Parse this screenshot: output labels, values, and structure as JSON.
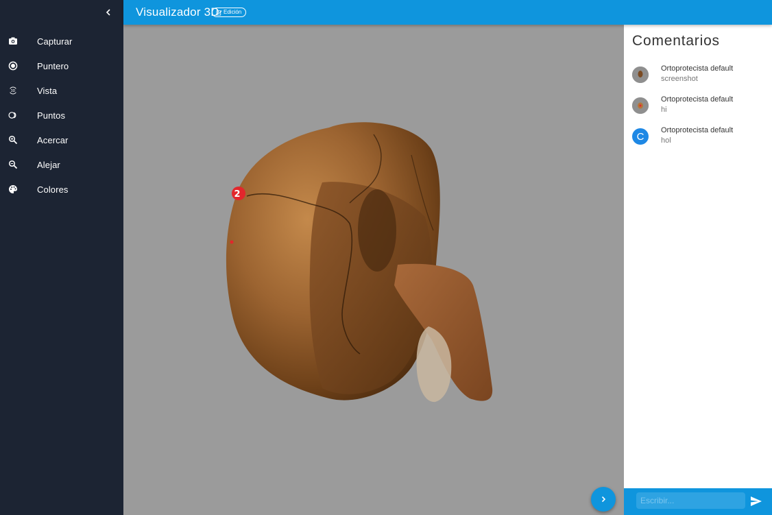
{
  "app": {
    "title": "Visualizador 3D",
    "mode_badge": "Edición"
  },
  "sidebar": {
    "items": [
      {
        "label": "Capturar",
        "icon": "camera-icon"
      },
      {
        "label": "Puntero",
        "icon": "radio-button-icon"
      },
      {
        "label": "Vista",
        "icon": "3d-rotation-icon"
      },
      {
        "label": "Puntos",
        "icon": "ring-icon"
      },
      {
        "label": "Acercar",
        "icon": "zoom-in-icon"
      },
      {
        "label": "Alejar",
        "icon": "zoom-out-icon"
      },
      {
        "label": "Colores",
        "icon": "palette-icon"
      }
    ]
  },
  "viewer": {
    "marker_label": "2"
  },
  "comments": {
    "title": "Comentarios",
    "items": [
      {
        "author": "Ortoprotecista default",
        "text": "screenshot",
        "avatar": "image"
      },
      {
        "author": "Ortoprotecista default",
        "text": "hi",
        "avatar": "image"
      },
      {
        "author": "Ortoprotecista default",
        "text": "hol",
        "avatar": "C"
      }
    ]
  },
  "composer": {
    "placeholder": "Escribir..."
  },
  "colors": {
    "sidebar": "#1c2433",
    "primary": "#0f95dd",
    "viewer_bg": "#9b9b9b"
  }
}
